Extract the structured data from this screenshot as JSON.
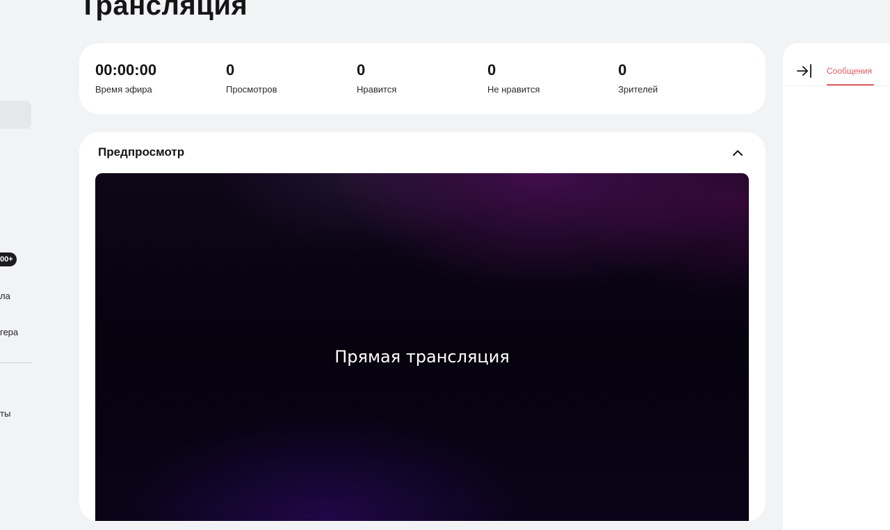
{
  "sidebar": {
    "badge": "00+",
    "item_1": "ла",
    "item_2": "гера",
    "item_3": "ты"
  },
  "page": {
    "title": "Трансляция"
  },
  "stats": [
    {
      "value": "00:00:00",
      "label": "Время эфира"
    },
    {
      "value": "0",
      "label": "Просмотров"
    },
    {
      "value": "0",
      "label": "Нравится"
    },
    {
      "value": "0",
      "label": "Не нравится"
    },
    {
      "value": "0",
      "label": "Зрителей"
    }
  ],
  "preview": {
    "title": "Предпросмотр",
    "video_label": "Прямая трансляция",
    "collapse_icon": "chevron-up-icon"
  },
  "chat": {
    "tab_label": "Сообщения",
    "collapse_icon": "collapse-right-icon"
  },
  "colors": {
    "background": "#f2f3f5",
    "card": "#ffffff",
    "accent": "#e05a62",
    "text": "#151515"
  }
}
